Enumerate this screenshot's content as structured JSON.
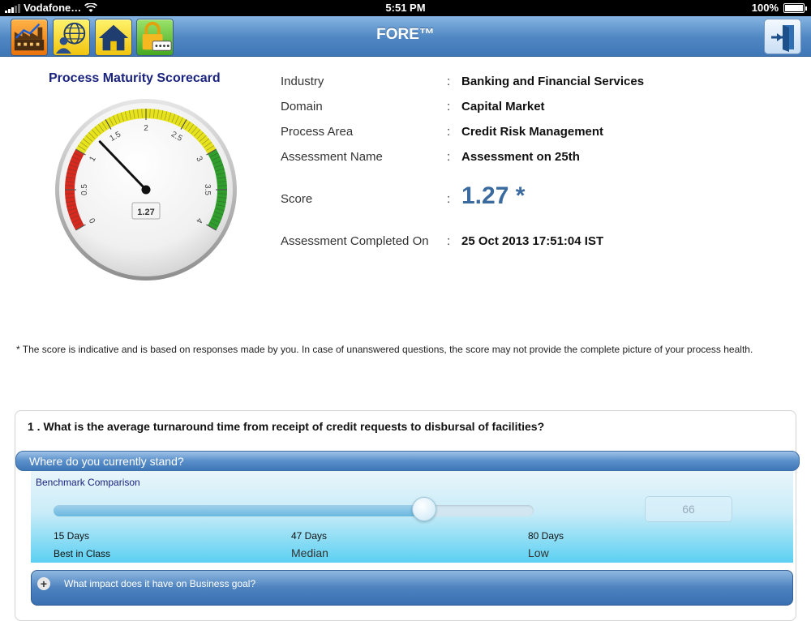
{
  "status_bar": {
    "carrier": "Vodafone…",
    "time": "5:51 PM",
    "battery": "100%"
  },
  "nav": {
    "title": "FORE™",
    "icons": [
      "factory-icon",
      "globe-user-icon",
      "home-icon",
      "lock-password-icon",
      "exit-door-icon"
    ]
  },
  "scorecard": {
    "title": "Process Maturity Scorecard",
    "gauge": {
      "min": 0,
      "max": 4,
      "value": 1.27,
      "value_label": "1.27",
      "tick_labels": [
        "0",
        "0.5",
        "1",
        "1.5",
        "2",
        "2.5",
        "3",
        "3.5",
        "4"
      ],
      "zones": [
        {
          "from": 0,
          "to": 1,
          "color": "#d62a1e"
        },
        {
          "from": 1,
          "to": 3,
          "color": "#e6e21c"
        },
        {
          "from": 3,
          "to": 4,
          "color": "#2f9e2c"
        }
      ]
    }
  },
  "info": {
    "industry_label": "Industry",
    "industry_value": "Banking and Financial Services",
    "domain_label": "Domain",
    "domain_value": "Capital Market",
    "process_label": "Process Area",
    "process_value": "Credit Risk Management",
    "assessment_label": "Assessment Name",
    "assessment_value": "Assessment on 25th",
    "score_label": "Score",
    "score_value": "1.27 *",
    "completed_label": "Assessment Completed On",
    "completed_value": "25 Oct 2013 17:51:04 IST",
    "colon": ":"
  },
  "note": "* The score is indicative and is based on responses made by you. In case of unanswered questions, the score may not provide the complete picture of your process health.",
  "question": {
    "text": "1 . What is the average turnaround time from receipt of credit requests to disbursal of facilities?",
    "stand_label": "Where do you currently stand?",
    "benchmark_title": "Benchmark Comparison",
    "slider_value": "66",
    "slider_min": 15,
    "slider_max": 80,
    "slider_current": 66,
    "points": [
      {
        "days": "15 Days",
        "label": "Best in Class"
      },
      {
        "days": "47 Days",
        "label": "Median"
      },
      {
        "days": "80 Days",
        "label": "Low"
      }
    ],
    "impact_label": "What impact does it have on Business goal?",
    "plus": "+"
  },
  "colors": {
    "accent": "#4f86c2",
    "title_navy": "#1a237e",
    "score_blue": "#3a6a9e"
  }
}
